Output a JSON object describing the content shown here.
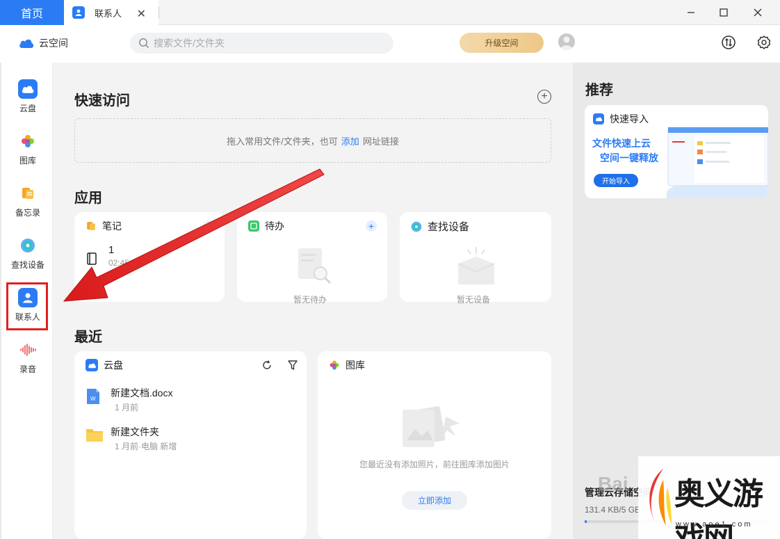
{
  "tabs": {
    "home_label": "首页",
    "contacts_label": "联系人"
  },
  "header": {
    "app_name": "云空间",
    "search_placeholder": "搜索文件/文件夹",
    "upgrade_label": "升级空间"
  },
  "sidebar": {
    "items": [
      {
        "label": "云盘",
        "icon": "cloud-icon"
      },
      {
        "label": "图库",
        "icon": "gallery-icon"
      },
      {
        "label": "备忘录",
        "icon": "notes-icon"
      },
      {
        "label": "查找设备",
        "icon": "find-device-icon"
      },
      {
        "label": "联系人",
        "icon": "contacts-icon"
      },
      {
        "label": "录音",
        "icon": "recording-icon"
      }
    ]
  },
  "quick_access": {
    "title": "快速访问",
    "drop_text_before": "拖入常用文件/文件夹，也可",
    "drop_link": "添加",
    "drop_text_after": "网址链接"
  },
  "apps": {
    "title": "应用",
    "notes": {
      "title": "笔记",
      "item_title": "1",
      "item_time": "02:45"
    },
    "todo": {
      "title": "待办",
      "empty": "暂无待办"
    },
    "find_device": {
      "title": "查找设备",
      "empty": "暂无设备"
    }
  },
  "recent": {
    "title": "最近",
    "cloud": {
      "title": "云盘",
      "files": [
        {
          "name": "新建文档.docx",
          "meta": "1 月前"
        },
        {
          "name": "新建文件夹",
          "meta": "1 月前·电脑 新增"
        }
      ]
    },
    "gallery": {
      "title": "图库",
      "empty": "您最近没有添加照片，前往图库添加图片",
      "add_button": "立即添加"
    }
  },
  "recommend": {
    "title": "推荐",
    "banner": {
      "head": "快速导入",
      "line1": "文件快速上云",
      "line2": "空间一键释放",
      "button": "开始导入"
    },
    "storage_title": "管理云存储空间",
    "storage_value": "131.4 KB/5 GB"
  },
  "watermark": {
    "site_name": "奥义游戏网",
    "url": "www.aoe1.com"
  },
  "colors": {
    "accent": "#2b7cf4",
    "highlight_box": "#e0201e",
    "arrow": "#e0201e"
  }
}
